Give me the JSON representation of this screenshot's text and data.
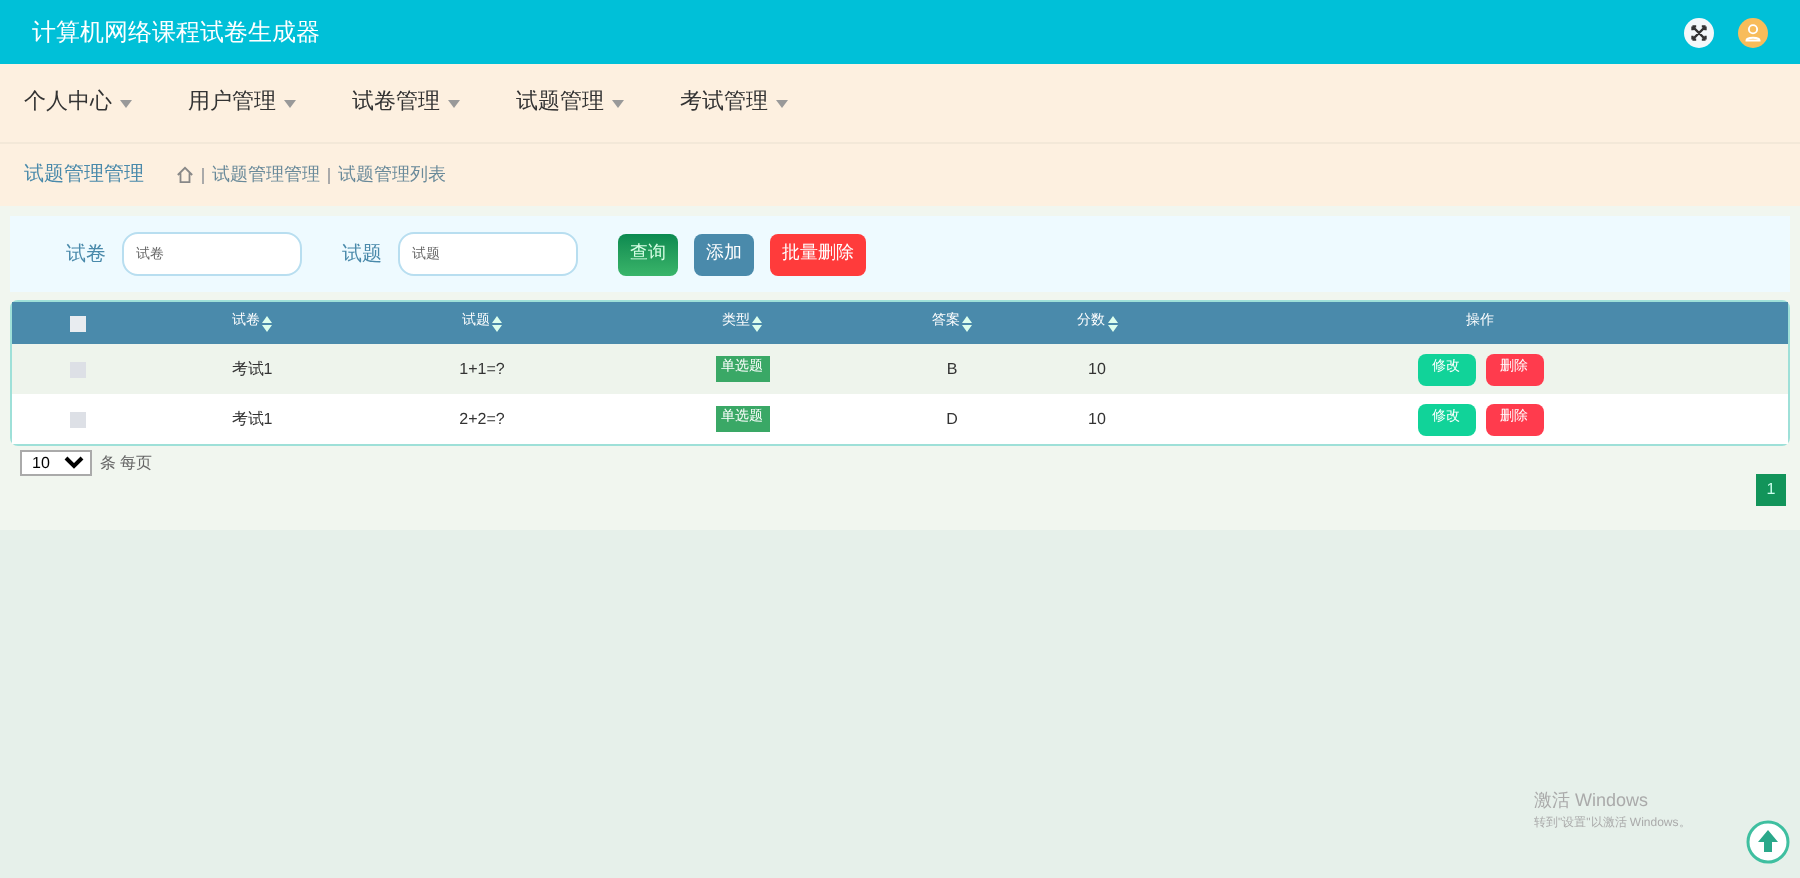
{
  "header": {
    "title": "计算机网络课程试卷生成器"
  },
  "nav": [
    {
      "label": "个人中心"
    },
    {
      "label": "用户管理"
    },
    {
      "label": "试卷管理"
    },
    {
      "label": "试题管理"
    },
    {
      "label": "考试管理"
    }
  ],
  "breadcrumb": {
    "title": "试题管理管理",
    "path": [
      "试题管理管理",
      "试题管理列表"
    ]
  },
  "search": {
    "fields": [
      {
        "label": "试卷",
        "placeholder": "试卷"
      },
      {
        "label": "试题",
        "placeholder": "试题"
      }
    ],
    "buttons": [
      {
        "label": "查询",
        "kind": "search"
      },
      {
        "label": "添加",
        "kind": "add"
      },
      {
        "label": "批量删除",
        "kind": "delete"
      }
    ]
  },
  "table": {
    "select_all_checked": false,
    "columns": [
      "试卷",
      "试题",
      "类型",
      "答案",
      "分数",
      "操作"
    ],
    "rows": [
      {
        "checked": false,
        "cells": [
          "考试1",
          "1+1=?",
          "单选题",
          "B",
          "10"
        ],
        "actions": [
          "修改",
          "删除"
        ]
      },
      {
        "checked": false,
        "cells": [
          "考试1",
          "2+2=?",
          "单选题",
          "D",
          "10"
        ],
        "actions": [
          "修改",
          "删除"
        ]
      }
    ]
  },
  "page_size": {
    "value": "10",
    "suffix": "条 每页"
  },
  "pagination": [
    {
      "label": "1",
      "selected": true
    }
  ],
  "os_notice": {
    "title": "激活 Windows",
    "text": "转到\"设置\"以激活 Windows。"
  }
}
